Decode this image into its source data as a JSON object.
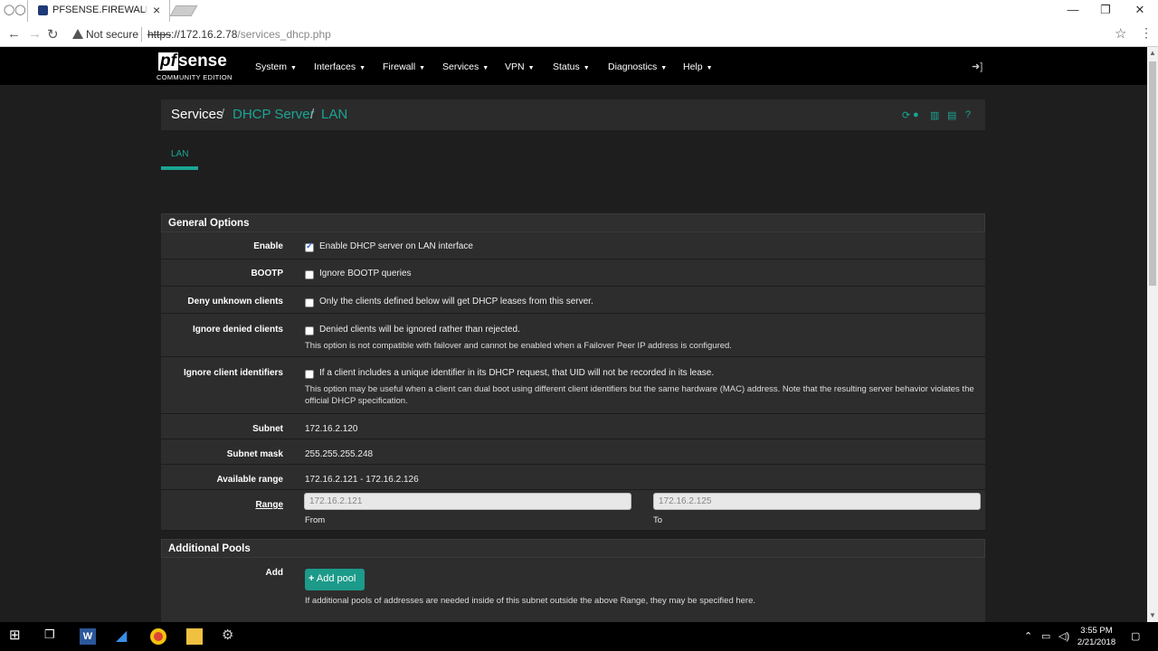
{
  "browser": {
    "tab_title": "PFSENSE.FIREWALL.COM",
    "security_label": "Not secure",
    "url_scheme": "https",
    "url_host": "://172.16.2.78",
    "url_path": "/services_dhcp.php"
  },
  "brand": {
    "logo_left": "pf",
    "logo_right": "sense",
    "edition": "COMMUNITY EDITION"
  },
  "nav": {
    "items": [
      "System",
      "Interfaces",
      "Firewall",
      "Services",
      "VPN",
      "Status",
      "Diagnostics",
      "Help"
    ]
  },
  "breadcrumb": {
    "root": "Services",
    "sep": "/",
    "middle": "DHCP Server",
    "current": "LAN"
  },
  "tabs": {
    "active": "LAN"
  },
  "general": {
    "title": "General Options",
    "enable": {
      "label": "Enable",
      "text": "Enable DHCP server on LAN interface",
      "checked": true
    },
    "bootp": {
      "label": "BOOTP",
      "text": "Ignore BOOTP queries",
      "checked": false
    },
    "deny": {
      "label": "Deny unknown clients",
      "text": "Only the clients defined below will get DHCP leases from this server.",
      "checked": false
    },
    "ignore_denied": {
      "label": "Ignore denied clients",
      "text": "Denied clients will be ignored rather than rejected.",
      "help": "This option is not compatible with failover and cannot be enabled when a Failover Peer IP address is configured.",
      "checked": false
    },
    "ignore_ids": {
      "label": "Ignore client identifiers",
      "text": "If a client includes a unique identifier in its DHCP request, that UID will not be recorded in its lease.",
      "help": "This option may be useful when a client can dual boot using different client identifiers but the same hardware (MAC) address. Note that the resulting server behavior violates the official DHCP specification.",
      "checked": false
    },
    "subnet": {
      "label": "Subnet",
      "value": "172.16.2.120"
    },
    "mask": {
      "label": "Subnet mask",
      "value": "255.255.255.248"
    },
    "avail": {
      "label": "Available range",
      "value": "172.16.2.121 - 172.16.2.126"
    },
    "range": {
      "label": "Range",
      "from_value": "172.16.2.121",
      "to_value": "172.16.2.125",
      "from_label": "From",
      "to_label": "To"
    }
  },
  "pools": {
    "title": "Additional Pools",
    "add_label": "Add",
    "button": "Add pool",
    "help": "If additional pools of addresses are needed inside of this subnet outside the above Range, they may be specified here."
  },
  "taskbar": {
    "time": "3:55 PM",
    "date": "2/21/2018"
  },
  "colors": {
    "accent": "#1aa594",
    "navbar": "#000000",
    "panel": "#2d2d2d"
  }
}
